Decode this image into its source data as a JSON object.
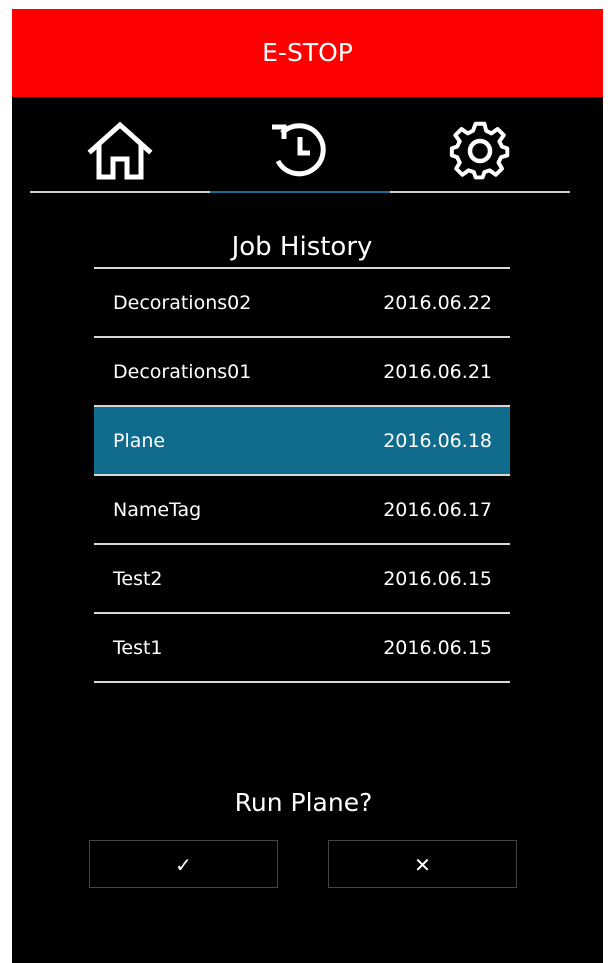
{
  "estop": {
    "label": "E-STOP",
    "color": "#ff0000"
  },
  "nav": {
    "tabs": [
      {
        "name": "home",
        "icon": "home-icon",
        "active": false
      },
      {
        "name": "history",
        "icon": "history-icon",
        "active": true
      },
      {
        "name": "settings",
        "icon": "gear-icon",
        "active": false
      }
    ],
    "active_color": "#1a6d8e"
  },
  "job_history": {
    "title": "Job History",
    "selected_index": 2,
    "selected_color": "#106b8d",
    "items": [
      {
        "name": "Decorations02",
        "date": "2016.06.22"
      },
      {
        "name": "Decorations01",
        "date": "2016.06.21"
      },
      {
        "name": "Plane",
        "date": "2016.06.18"
      },
      {
        "name": "NameTag",
        "date": "2016.06.17"
      },
      {
        "name": "Test2",
        "date": "2016.06.15"
      },
      {
        "name": "Test1",
        "date": "2016.06.15"
      }
    ]
  },
  "prompt": {
    "text": "Run Plane?"
  },
  "actions": {
    "confirm_label": "✓",
    "confirm_icon": "check-icon",
    "cancel_label": "✕",
    "cancel_icon": "close-icon"
  }
}
